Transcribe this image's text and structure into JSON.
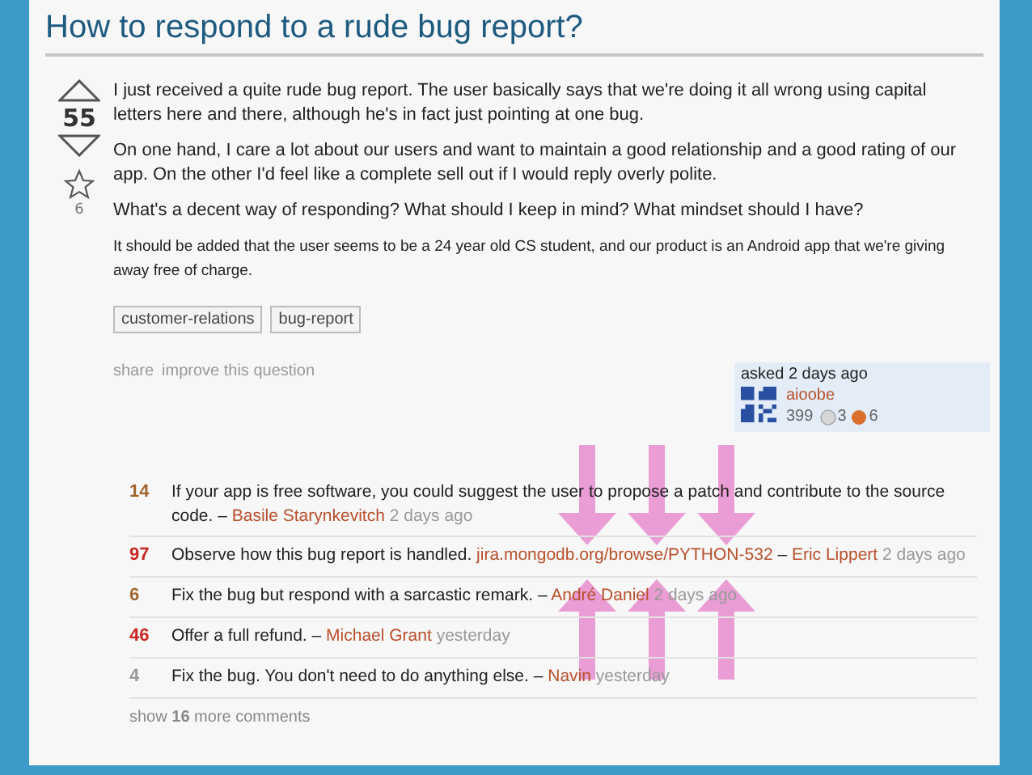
{
  "question": {
    "title": "How to respond to a rude bug report?",
    "votes": "55",
    "favorites": "6",
    "paragraphs": [
      "I just received a quite rude bug report. The user basically says that we're doing it all wrong using capital letters here and there, although he's in fact just pointing at one bug.",
      "On one hand, I care a lot about our users and want to maintain a good relationship and a good rating of our app. On the other I'd feel like a complete sell out if I would reply overly polite.",
      "What's a decent way of responding? What should I keep in mind? What mindset should I have?",
      "It should be added that the user seems to be a 24 year old CS student, and our product is an Android app that we're giving away free of charge."
    ],
    "tags": [
      "customer-relations",
      "bug-report"
    ],
    "actions": [
      "share",
      "improve this question"
    ],
    "owner": {
      "asked": "asked 2 days ago",
      "name": "aioobe",
      "reputation": "399",
      "silver": "3",
      "bronze": "6"
    }
  },
  "comments": [
    {
      "score": "14",
      "color": "#a0652e",
      "text": "If your app is free software, you could suggest the user to propose a patch and contribute to the source code.",
      "separator": "–",
      "author": "Basile Starynkevitch",
      "time": "2 days ago"
    },
    {
      "score": "97",
      "color": "#c8261e",
      "text": "Observe how this bug report is handled.",
      "link": "jira.mongodb.org/browse/PYTHON-532",
      "separator": "–",
      "author": "Eric Lippert",
      "time": "2 days ago"
    },
    {
      "score": "6",
      "color": "#a0652e",
      "text": "Fix the bug but respond with a sarcastic remark.",
      "separator": "–",
      "author": "André Daniel",
      "time": "2 days ago"
    },
    {
      "score": "46",
      "color": "#c8261e",
      "text": "Offer a full refund.",
      "separator": "–",
      "author": "Michael Grant",
      "time": "yesterday"
    },
    {
      "score": "4",
      "color": "#999999",
      "text": "Fix the bug. You don't need to do anything else.",
      "separator": "–",
      "author": "Navin",
      "time": "yesterday"
    }
  ],
  "more_comments": {
    "prefix": "show",
    "count": "16",
    "suffix": "more comments"
  }
}
